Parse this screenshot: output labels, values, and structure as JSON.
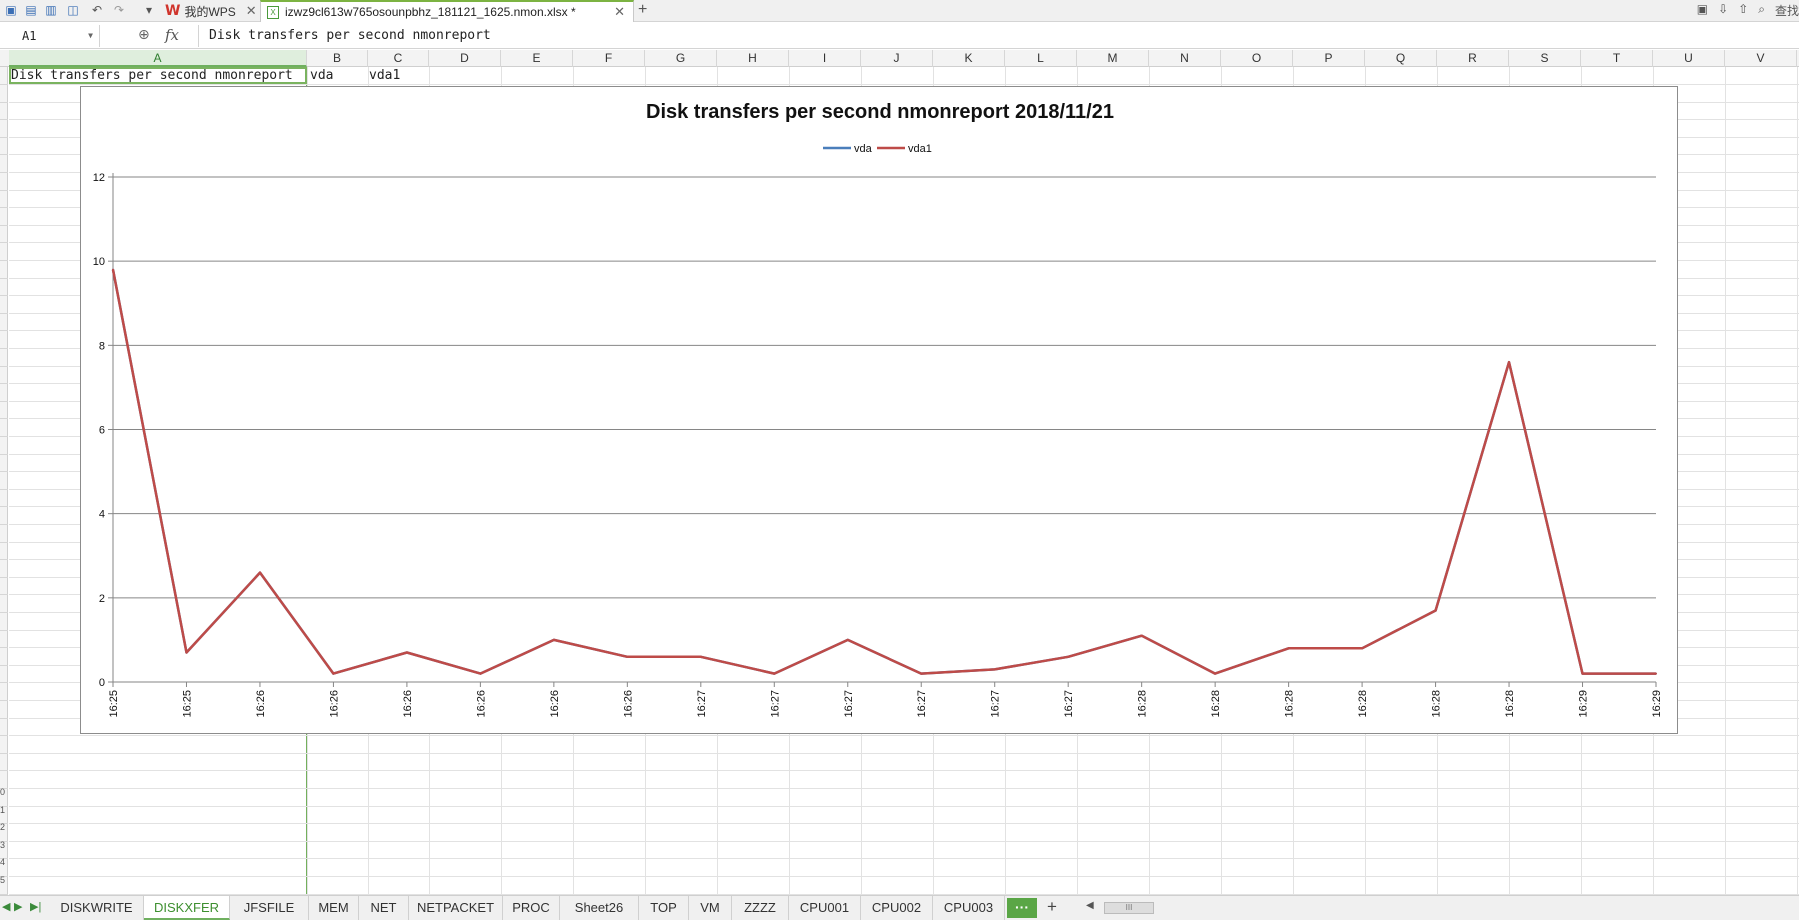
{
  "app": {
    "home_tab": "我的WPS",
    "file_tab": "izwz9cl613w765osounpbhz_181121_1625.nmon.xlsx *",
    "right_label": "查找"
  },
  "formula_bar": {
    "name_box": "A1",
    "fx_label": "fx",
    "formula": "Disk transfers per second nmonreport"
  },
  "columns": [
    "A",
    "B",
    "C",
    "D",
    "E",
    "F",
    "G",
    "H",
    "I",
    "J",
    "K",
    "L",
    "M",
    "N",
    "O",
    "P",
    "Q",
    "R",
    "S",
    "T",
    "U",
    "V"
  ],
  "selected_column": "A",
  "cells": {
    "a1": "Disk transfers per second nmonreport",
    "b1": "vda",
    "c1": "vda1"
  },
  "row_fragments": [
    "0",
    "1",
    "2",
    "3",
    "4",
    "5"
  ],
  "chart_data": {
    "type": "line",
    "title": "Disk transfers per second nmonreport  2018/11/21",
    "legend_position": "top",
    "categories": [
      "16:25",
      "16:25",
      "16:26",
      "16:26",
      "16:26",
      "16:26",
      "16:26",
      "16:26",
      "16:27",
      "16:27",
      "16:27",
      "16:27",
      "16:27",
      "16:27",
      "16:28",
      "16:28",
      "16:28",
      "16:28",
      "16:28",
      "16:28",
      "16:29",
      "16:29"
    ],
    "series": [
      {
        "name": "vda",
        "color": "#4a7ebb",
        "values": [
          9.8,
          0.7,
          2.6,
          0.2,
          0.7,
          0.2,
          1.0,
          0.6,
          0.6,
          0.2,
          1.0,
          0.2,
          0.3,
          0.6,
          1.1,
          0.2,
          0.8,
          0.8,
          1.7,
          7.6,
          0.2,
          0.2
        ]
      },
      {
        "name": "vda1",
        "color": "#be4b48",
        "values": [
          9.8,
          0.7,
          2.6,
          0.2,
          0.7,
          0.2,
          1.0,
          0.6,
          0.6,
          0.2,
          1.0,
          0.2,
          0.3,
          0.6,
          1.1,
          0.2,
          0.8,
          0.8,
          1.7,
          7.6,
          0.2,
          0.2
        ]
      }
    ],
    "ylim": [
      0,
      12
    ],
    "yticks": [
      0,
      2,
      4,
      6,
      8,
      10,
      12
    ],
    "grid": true
  },
  "sheet_tabs": [
    {
      "label": "DISKWRITE",
      "active": false
    },
    {
      "label": "DISKXFER",
      "active": true
    },
    {
      "label": "JFSFILE",
      "active": false
    },
    {
      "label": "MEM",
      "active": false
    },
    {
      "label": "NET",
      "active": false
    },
    {
      "label": "NETPACKET",
      "active": false
    },
    {
      "label": "PROC",
      "active": false
    },
    {
      "label": "Sheet26",
      "active": false
    },
    {
      "label": "TOP",
      "active": false
    },
    {
      "label": "VM",
      "active": false
    },
    {
      "label": "ZZZZ",
      "active": false
    },
    {
      "label": "CPU001",
      "active": false
    },
    {
      "label": "CPU002",
      "active": false
    },
    {
      "label": "CPU003",
      "active": false
    }
  ],
  "more_tabs_label": "···",
  "scroll_thumb_label": "III"
}
